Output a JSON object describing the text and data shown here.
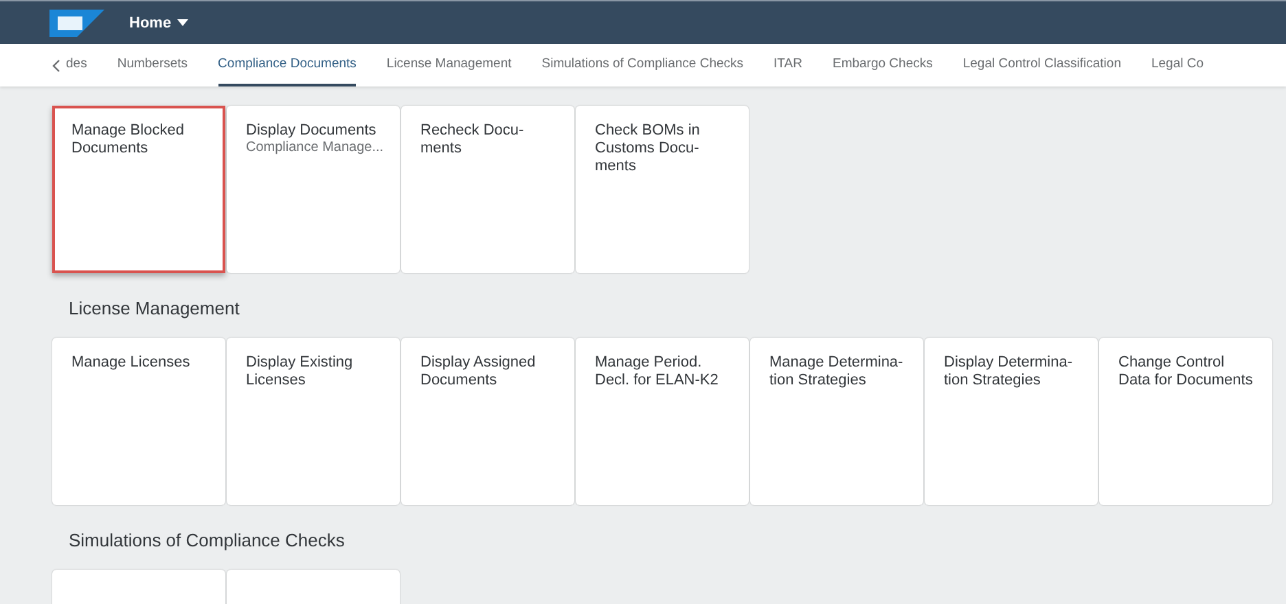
{
  "shell_bar": {
    "title": "Home"
  },
  "tabs": [
    {
      "label": "des",
      "selected": false
    },
    {
      "label": "Numbersets",
      "selected": false
    },
    {
      "label": "Compliance Documents",
      "selected": true
    },
    {
      "label": "License Management",
      "selected": false
    },
    {
      "label": "Simulations of Compliance Checks",
      "selected": false
    },
    {
      "label": "ITAR",
      "selected": false
    },
    {
      "label": "Embargo Checks",
      "selected": false
    },
    {
      "label": "Legal Control Classification",
      "selected": false
    },
    {
      "label": "Legal Co",
      "selected": false
    }
  ],
  "groups": [
    {
      "tiles": [
        {
          "title": "Manage Blocked Documents",
          "highlighted": true
        },
        {
          "title": "Display Documents",
          "subtitle": "Compliance Manage...",
          "highlighted": false
        },
        {
          "title": "Recheck Docu-\nments",
          "highlighted": false
        },
        {
          "title": "Check BOMs in\nCustoms Docu-\nments",
          "highlighted": false
        }
      ]
    },
    {
      "title": "License Management",
      "tiles": [
        {
          "title": "Manage Licenses",
          "highlighted": false
        },
        {
          "title": "Display Existing\nLicenses",
          "highlighted": false
        },
        {
          "title": "Display Assigned\nDocuments",
          "highlighted": false
        },
        {
          "title": "Manage Period.\nDecl. for ELAN-K2",
          "highlighted": false
        },
        {
          "title": "Manage Determina-\ntion Strategies",
          "highlighted": false
        },
        {
          "title": "Display Determina-\ntion Strategies",
          "highlighted": false
        },
        {
          "title": "Change Control\nData for Documents",
          "highlighted": false
        }
      ]
    },
    {
      "title": "Simulations of Compliance Checks",
      "tiles": [
        {
          "highlighted": false
        },
        {
          "highlighted": false
        }
      ]
    }
  ]
}
